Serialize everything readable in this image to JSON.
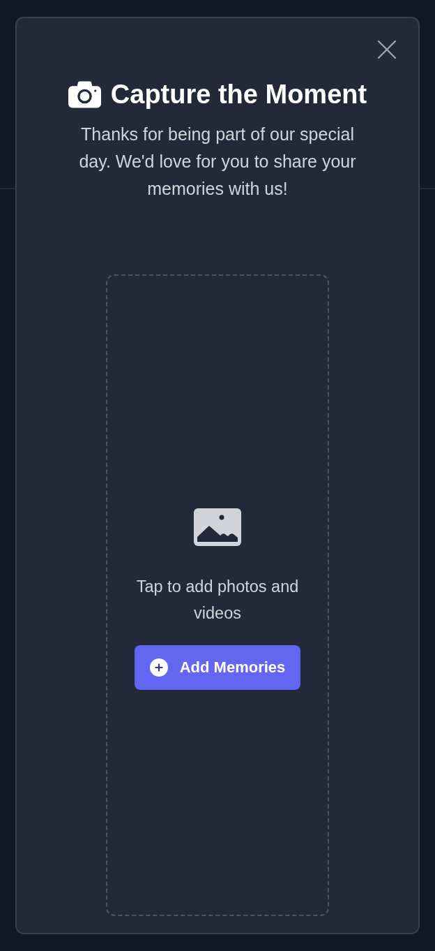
{
  "modal": {
    "title": "Capture the Moment",
    "subtitle": "Thanks for being part of our special day. We'd love for you to share your memories with us!",
    "upload": {
      "hint": "Tap to add photos and videos",
      "button": "Add Memories"
    }
  }
}
